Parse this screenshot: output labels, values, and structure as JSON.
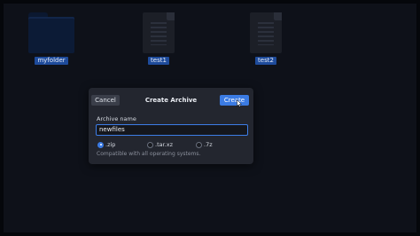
{
  "desktop": {
    "items": [
      {
        "label": "myfolder",
        "type": "folder"
      },
      {
        "label": "test1",
        "type": "document"
      },
      {
        "label": "test2",
        "type": "document"
      }
    ]
  },
  "dialog": {
    "title": "Create Archive",
    "cancel_label": "Cancel",
    "create_label": "Create",
    "name_label": "Archive name",
    "name_value": "newfiles",
    "formats": [
      {
        "label": ".zip",
        "checked": true
      },
      {
        "label": ".tar.xz",
        "checked": false
      },
      {
        "label": ".7z",
        "checked": false
      }
    ],
    "hint": "Compatible with all operating systems."
  },
  "colors": {
    "accent": "#3b7be3",
    "selection": "#1e4b9b",
    "dialog_bg": "#23262f",
    "desktop_bg": "#0e1119"
  }
}
